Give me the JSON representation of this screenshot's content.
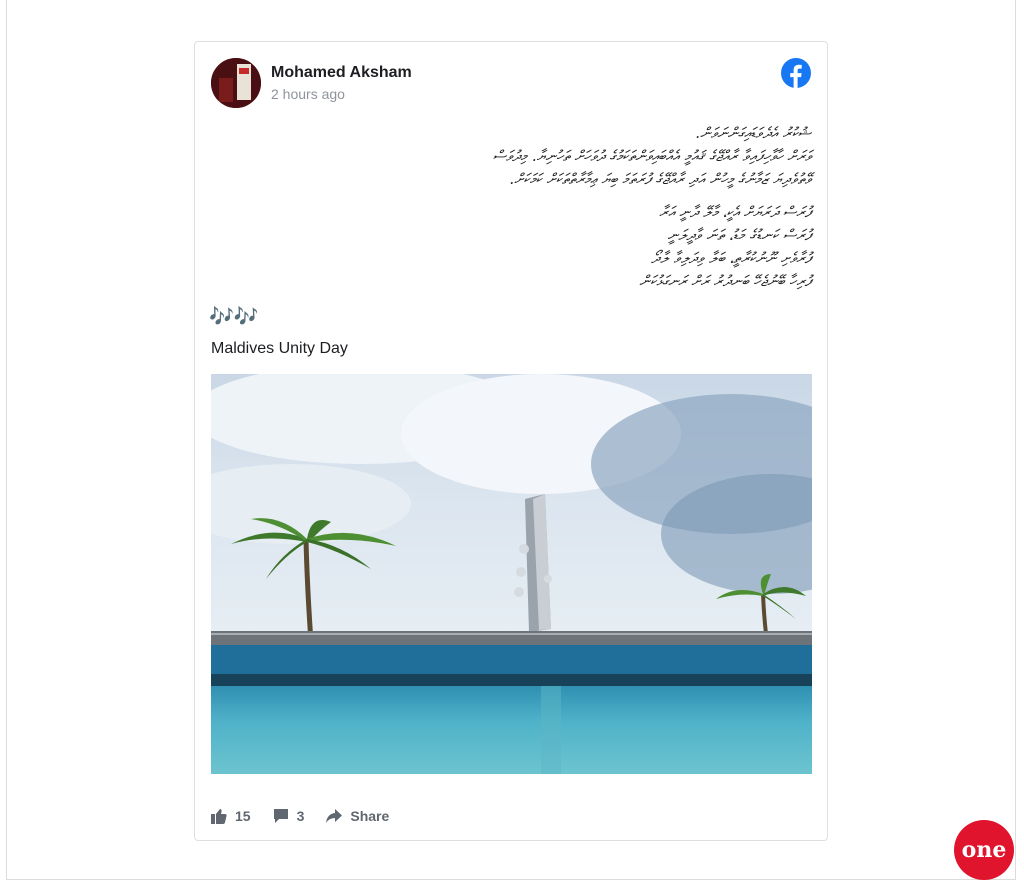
{
  "post": {
    "author": "Mohamed Aksham",
    "time": "2 hours ago",
    "text_lines": [
      "ޝުކުރު އެދެވަޑައިގަންނަވަން.",
      "ވަރަށް ހާވާހިފައިވާ ރާއްޖޭގެ ޤައުމީ އެއްބައިވަންތަކަމުގެ ދުވަހަށް ތަހުނިޔާ. މިދުވަސް",
      "ވޭތުވެދިޔަ ޒަމާނުގެ މީހުން އަދި ރާއްޖޭގެ ފުރަތަމަ ބިޔަ ޢިމާރާތްތަކަށް ކަމަކަށް.",
      "",
      "ފުރަސް ދަރަޔަށް އެކީ، މާލޭ ދާނީ އަރާ",
      "ފުރަސް ކަނޑުގެ މަޑު، ތަނަ ވާދީލަނީ",
      "ފުރާވެށި ނޫނުކުރާތީ، ބަލާ ވިދަލިވާ ލާދޯ",
      "ފުރިހާ ބޭނުޖެހޭ ބަނދުރު ރަށް ރަނގަޅުކަން"
    ],
    "music": "🎶🎶",
    "caption": "Maldives Unity Day",
    "photo_alt": "Maldives Unity Day monument by the sea",
    "likes": "15",
    "comments": "3",
    "share_label": "Share"
  },
  "brand": {
    "facebook_color": "#1877f2",
    "badge_text": "one",
    "badge_color": "#e0142c"
  }
}
